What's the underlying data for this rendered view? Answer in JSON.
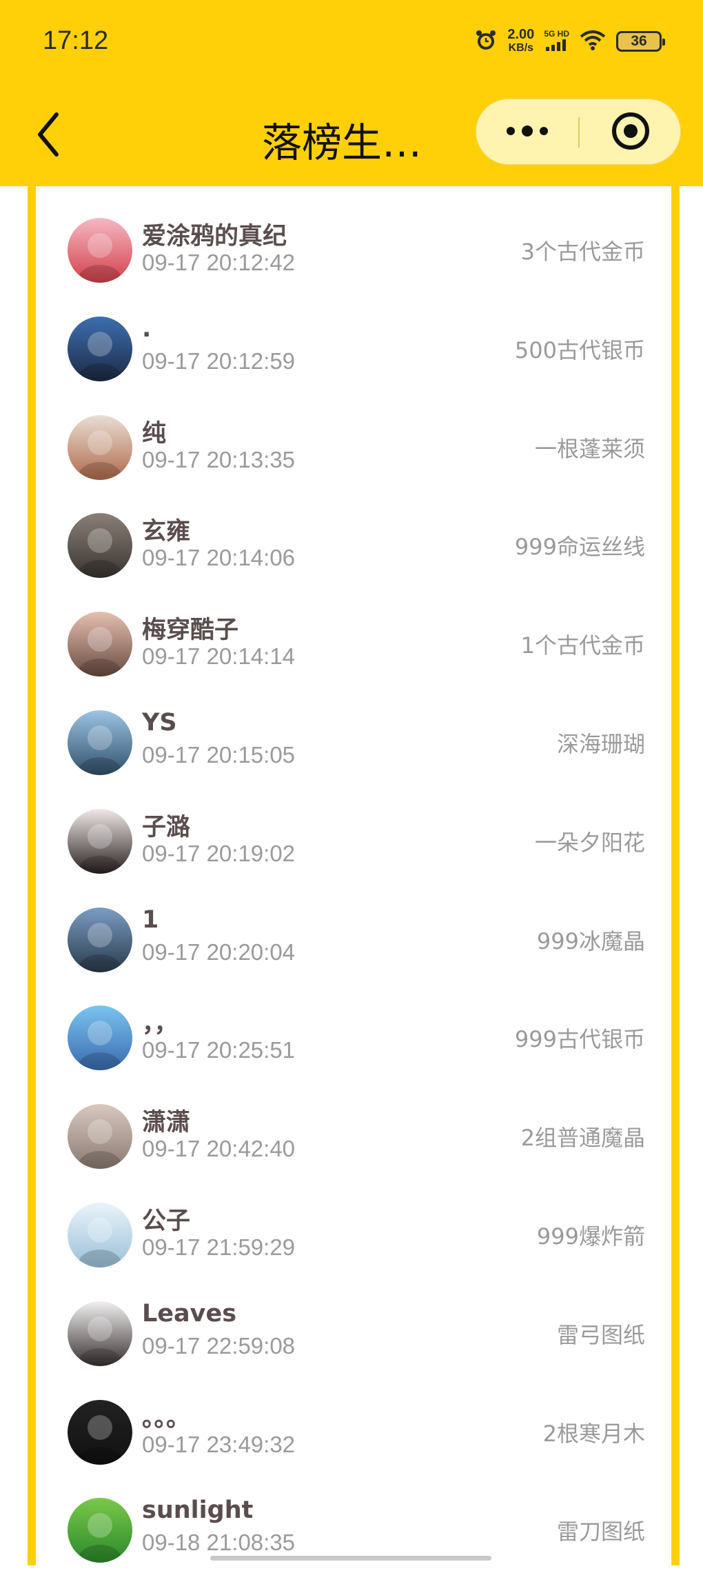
{
  "status_bar": {
    "time": "17:12",
    "net_speed_value": "2.00",
    "net_speed_unit": "KB/s",
    "signal_label": "5G HD",
    "battery": "36"
  },
  "nav": {
    "title": "落榜生…"
  },
  "colors": {
    "accent": "#FFD007",
    "name_text": "#5a4d4d",
    "meta_text": "#9a9a9a"
  },
  "entries": [
    {
      "name": "爱涂鸦的真纪",
      "time": "09-17 20:12:42",
      "reward": "3个古代金币"
    },
    {
      "name": ".",
      "time": "09-17 20:12:59",
      "reward": "500古代银币"
    },
    {
      "name": "纯",
      "time": "09-17 20:13:35",
      "reward": "一根蓬莱须"
    },
    {
      "name": "玄雍",
      "time": "09-17 20:14:06",
      "reward": "999命运丝线"
    },
    {
      "name": "梅穿酷子",
      "time": "09-17 20:14:14",
      "reward": "1个古代金币"
    },
    {
      "name": "YS",
      "time": "09-17 20:15:05",
      "reward": "深海珊瑚"
    },
    {
      "name": "子潞",
      "time": "09-17 20:19:02",
      "reward": "一朵夕阳花"
    },
    {
      "name": "1",
      "time": "09-17 20:20:04",
      "reward": "999冰魔晶"
    },
    {
      "name": "，，",
      "time": "09-17 20:25:51",
      "reward": "999古代银币"
    },
    {
      "name": "潇潇",
      "time": "09-17 20:42:40",
      "reward": "2组普通魔晶"
    },
    {
      "name": "公子",
      "time": "09-17 21:59:29",
      "reward": "999爆炸箭"
    },
    {
      "name": "Leaves",
      "time": "09-17 22:59:08",
      "reward": "雷弓图纸"
    },
    {
      "name": "。。。",
      "time": "09-17 23:49:32",
      "reward": "2根寒月木"
    },
    {
      "name": "sunlight",
      "time": "09-18 21:08:35",
      "reward": "雷刀图纸"
    }
  ]
}
